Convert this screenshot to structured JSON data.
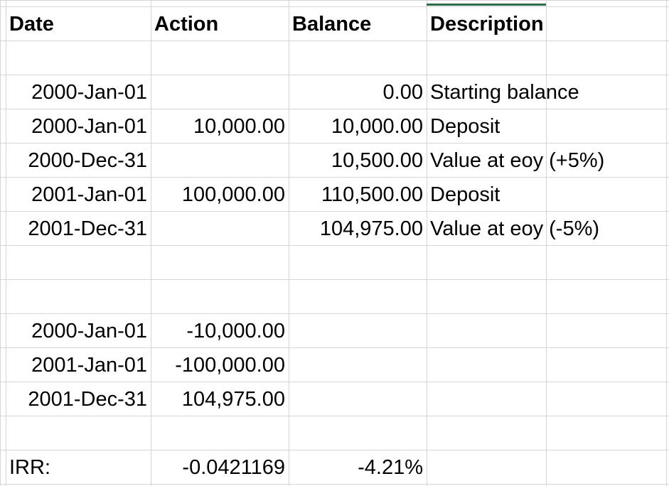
{
  "headers": {
    "date": "Date",
    "action": "Action",
    "balance": "Balance",
    "description": "Description"
  },
  "rows": [
    {
      "date": "2000-Jan-01",
      "action": "",
      "balance": "0.00",
      "description": "Starting balance"
    },
    {
      "date": "2000-Jan-01",
      "action": "10,000.00",
      "balance": "10,000.00",
      "description": "Deposit"
    },
    {
      "date": "2000-Dec-31",
      "action": "",
      "balance": "10,500.00",
      "description": "Value at eoy (+5%)"
    },
    {
      "date": "2001-Jan-01",
      "action": "100,000.00",
      "balance": "110,500.00",
      "description": "Deposit"
    },
    {
      "date": "2001-Dec-31",
      "action": "",
      "balance": "104,975.00",
      "description": "Value at eoy (-5%)"
    }
  ],
  "cashflows": [
    {
      "date": "2000-Jan-01",
      "amount": "-10,000.00"
    },
    {
      "date": "2001-Jan-01",
      "amount": "-100,000.00"
    },
    {
      "date": "2001-Dec-31",
      "amount": "104,975.00"
    }
  ],
  "irr": {
    "label": "IRR:",
    "value": "-0.0421169",
    "percent": "-4.21%"
  },
  "colors": {
    "gridline": "#d4d4d4",
    "active_cell": "#217346"
  }
}
